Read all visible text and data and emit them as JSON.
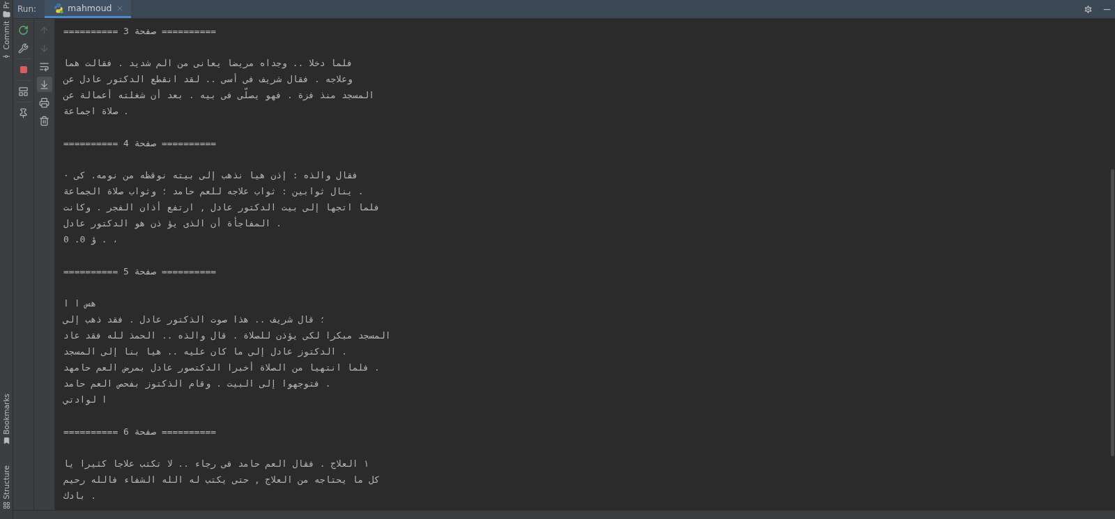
{
  "tool_stripe": {
    "top": [
      {
        "label": "Pr",
        "kind": "project"
      },
      {
        "label": "Commit",
        "kind": "commit"
      }
    ],
    "bottom": [
      {
        "label": "Bookmarks",
        "kind": "bookmarks"
      },
      {
        "label": "Structure",
        "kind": "structure"
      }
    ]
  },
  "run_bar": {
    "label": "Run:",
    "tabs": [
      {
        "label": "mahmoud",
        "selected": true
      }
    ]
  },
  "run_actions": [
    {
      "kind": "rerun"
    },
    {
      "kind": "settings"
    },
    {
      "kind": "stop"
    },
    {
      "kind": "layout"
    },
    {
      "kind": "pin"
    }
  ],
  "console_actions": [
    {
      "kind": "up",
      "disabled": true,
      "on": false
    },
    {
      "kind": "down",
      "disabled": true,
      "on": false
    },
    {
      "kind": "wrap",
      "disabled": false,
      "on": false
    },
    {
      "kind": "scroll_end",
      "disabled": false,
      "on": true
    },
    {
      "kind": "print",
      "disabled": false,
      "on": false
    },
    {
      "kind": "clear",
      "disabled": false,
      "on": false
    }
  ],
  "console": {
    "pages": [
      {
        "header": "========== صفحة 3 ==========",
        "lines": [
          "فلما دخلا .. وجداه مريضا يعانى من الم شديد . فقالت هما",
          "وعلاجه . فقال شريف فى أسى .. لقد انقطع الدكتور عادل عن",
          "المسجد منذ فزة . فهو يصلّى فى بيه . بعد أن شغلته أعمالة عن",
          "صلاة اجماعة ."
        ]
      },
      {
        "header": "========== صفحة 4 ==========",
        "lines": [
          "· فقال والذه : إذن هيا نذهب إلى بيته نوقظه من نومه. كى",
          "ينال ثوابين : ثواب علاجه للعم حامد ؛ وثواب صلاة الجماعة .",
          "فلما اتجها إلى بيت الدكتور عادل , ارتفع أذان الفجر . وكانت",
          "المفاجأة أن الذى يؤ ذن هو الدكتور عادل .",
          "ؤ 0. 0 . ،"
        ]
      },
      {
        "header": "========== صفحة 5 ==========",
        "lines": [
          "هس ا ا",
          "؛ قال شريف .. هذا صوت الذكتور عادل . فقد ذهب إلى",
          "المسجد مبكرا لكى يؤذن للصلاة . قال والذه .. الحمذ لله فقد عاد",
          "الدكتوز عادل إلى ما كان عليه .. هيا بنا إلى المسجد .",
          "فلما انتهيا من الصلاة أخبرا الدكتصور عادل بمرض العم حامهد .",
          "فتوجهوا إلى البيت . وقام الذكتوز بفحص العم حامد .",
          "ا لوادتي"
        ]
      },
      {
        "header": "========== صفحة 6 ==========",
        "lines": [
          "١ العلاج . فقال العم حامد فى رجاء .. لا تكتب علاجا كثيرا يا",
          "كل ما يحتاجه من العلاج , حتى يكتب له الله الشفاء فالله رحيم",
          "بادك ."
        ]
      }
    ]
  }
}
